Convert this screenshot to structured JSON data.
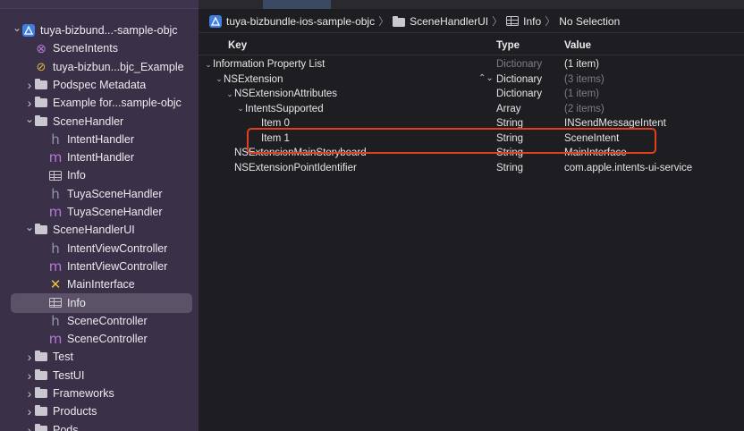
{
  "sidebar": {
    "items": [
      {
        "label": "tuya-bizbund...-sample-objc",
        "icon": "project-icon",
        "chevron": "v",
        "indent": 0
      },
      {
        "label": "SceneIntents",
        "icon": "scene-intents-icon",
        "chevron": "",
        "indent": 1
      },
      {
        "label": "tuya-bizbun...bjc_Example",
        "icon": "target-icon",
        "chevron": "",
        "indent": 1
      },
      {
        "label": "Podspec Metadata",
        "icon": "folder-icon",
        "chevron": ">",
        "indent": 1
      },
      {
        "label": "Example for...sample-objc",
        "icon": "folder-icon",
        "chevron": ">",
        "indent": 1
      },
      {
        "label": "SceneHandler",
        "icon": "folder-icon",
        "chevron": "v",
        "indent": 1
      },
      {
        "label": "IntentHandler",
        "icon": "h-file-icon",
        "chevron": "",
        "indent": 2
      },
      {
        "label": "IntentHandler",
        "icon": "m-file-icon",
        "chevron": "",
        "indent": 2
      },
      {
        "label": "Info",
        "icon": "plist-icon",
        "chevron": "",
        "indent": 2
      },
      {
        "label": "TuyaSceneHandler",
        "icon": "h-file-icon",
        "chevron": "",
        "indent": 2
      },
      {
        "label": "TuyaSceneHandler",
        "icon": "m-file-icon",
        "chevron": "",
        "indent": 2
      },
      {
        "label": "SceneHandlerUI",
        "icon": "folder-icon",
        "chevron": "v",
        "indent": 1
      },
      {
        "label": "IntentViewController",
        "icon": "h-file-icon",
        "chevron": "",
        "indent": 2
      },
      {
        "label": "IntentViewController",
        "icon": "m-file-icon",
        "chevron": "",
        "indent": 2
      },
      {
        "label": "MainInterface",
        "icon": "storyboard-icon",
        "chevron": "",
        "indent": 2
      },
      {
        "label": "Info",
        "icon": "plist-icon",
        "chevron": "",
        "indent": 2,
        "selected": true
      },
      {
        "label": "SceneController",
        "icon": "h-file-icon",
        "chevron": "",
        "indent": 2
      },
      {
        "label": "SceneController",
        "icon": "m-file-icon",
        "chevron": "",
        "indent": 2
      },
      {
        "label": "Test",
        "icon": "folder-icon",
        "chevron": ">",
        "indent": 1
      },
      {
        "label": "TestUI",
        "icon": "folder-icon",
        "chevron": ">",
        "indent": 1
      },
      {
        "label": "Frameworks",
        "icon": "folder-icon",
        "chevron": ">",
        "indent": 1
      },
      {
        "label": "Products",
        "icon": "folder-icon",
        "chevron": ">",
        "indent": 1
      },
      {
        "label": "Pods",
        "icon": "folder-icon",
        "chevron": ">",
        "indent": 1
      }
    ]
  },
  "jumpbar": {
    "project": "tuya-bizbundle-ios-sample-objc",
    "group": "SceneHandlerUI",
    "file": "Info",
    "selection": "No Selection"
  },
  "plist": {
    "headers": {
      "key": "Key",
      "type": "Type",
      "value": "Value"
    },
    "rows": [
      {
        "key": "Information Property List",
        "type": "Dictionary",
        "value": "(1 item)",
        "depth": 0,
        "chevron": "v",
        "dim_type": true,
        "dim_value": false
      },
      {
        "key": "NSExtension",
        "type": "Dictionary",
        "value": "(3 items)",
        "depth": 1,
        "chevron": "v",
        "stepper": true,
        "dim_type": false,
        "dim_value": true
      },
      {
        "key": "NSExtensionAttributes",
        "type": "Dictionary",
        "value": "(1 item)",
        "depth": 2,
        "chevron": "v",
        "dim_type": false,
        "dim_value": true
      },
      {
        "key": "IntentsSupported",
        "type": "Array",
        "value": "(2 items)",
        "depth": 3,
        "chevron": "v",
        "dim_type": false,
        "dim_value": true
      },
      {
        "key": "Item 0",
        "type": "String",
        "value": "INSendMessageIntent",
        "depth": 4,
        "chevron": "",
        "dim_type": false,
        "dim_value": false
      },
      {
        "key": "Item 1",
        "type": "String",
        "value": "SceneIntent",
        "depth": 4,
        "chevron": "",
        "dim_type": false,
        "dim_value": false
      },
      {
        "key": "NSExtensionMainStoryboard",
        "type": "String",
        "value": "MainInterface",
        "depth": 2,
        "chevron": "",
        "dim_type": false,
        "dim_value": false
      },
      {
        "key": "NSExtensionPointIdentifier",
        "type": "String",
        "value": "com.apple.intents-ui-service",
        "depth": 2,
        "chevron": "",
        "dim_type": false,
        "dim_value": false
      }
    ]
  },
  "colors": {
    "sidebar_bg": "#3a3047",
    "selection": "#5b5268",
    "editor_bg": "#1e1e22",
    "highlight": "#e0401e"
  }
}
